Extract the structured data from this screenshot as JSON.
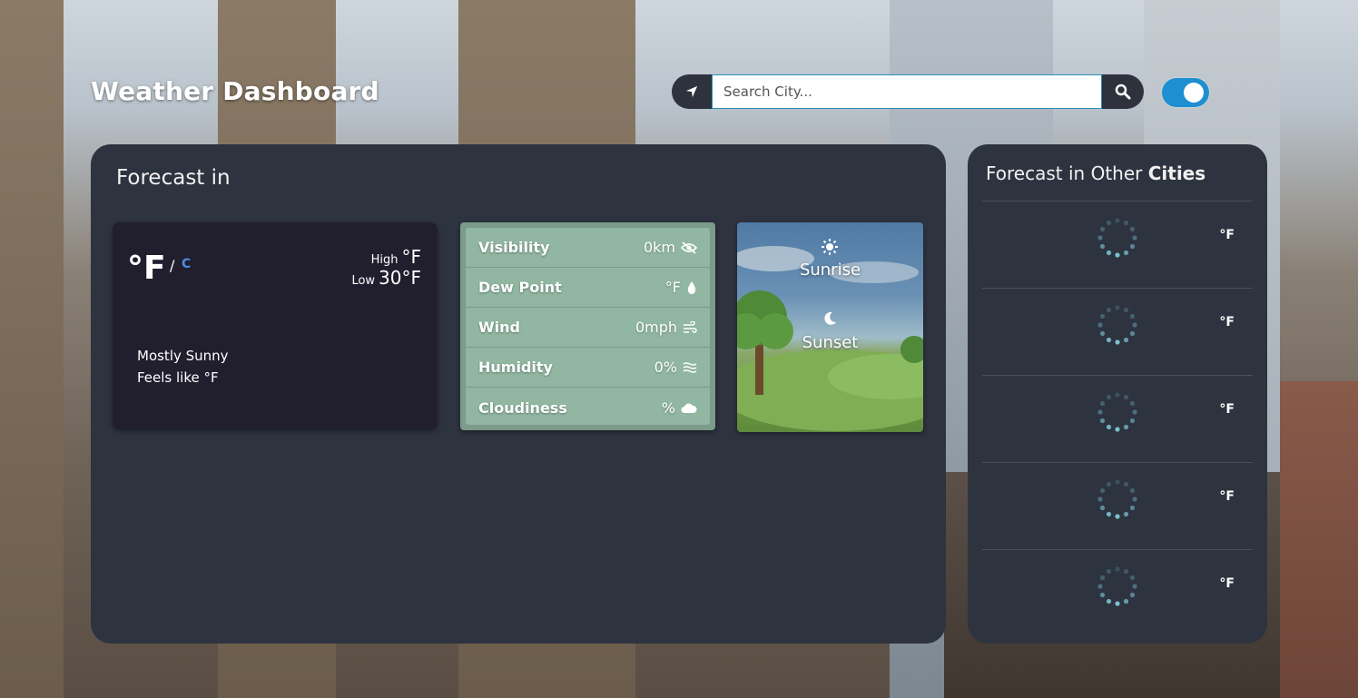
{
  "app": {
    "title": "Weather Dashboard"
  },
  "search": {
    "placeholder": "Search City..."
  },
  "main": {
    "heading": "Forecast in",
    "current": {
      "temp": "°F",
      "unit_sep": "/",
      "unit_alt": "C",
      "high_label": "High",
      "high_value": "°F",
      "low_label": "Low",
      "low_value": "30°F",
      "condition": "Mostly Sunny",
      "feels_like": "Feels like °F"
    },
    "details": [
      {
        "label": "Visibility",
        "value": "0km",
        "icon": "eye-slash-icon"
      },
      {
        "label": "Dew Point",
        "value": "°F",
        "icon": "droplet-icon"
      },
      {
        "label": "Wind",
        "value": "0mph",
        "icon": "wind-icon"
      },
      {
        "label": "Humidity",
        "value": "0%",
        "icon": "humidity-icon"
      },
      {
        "label": "Cloudiness",
        "value": "%",
        "icon": "cloud-icon"
      }
    ],
    "sun": {
      "sunrise": "Sunrise",
      "sunset": "Sunset"
    }
  },
  "side": {
    "heading_prefix": "Forecast in Other ",
    "heading_bold": "Cities",
    "cities": [
      {
        "unit": "°F"
      },
      {
        "unit": "°F"
      },
      {
        "unit": "°F"
      },
      {
        "unit": "°F"
      },
      {
        "unit": "°F"
      }
    ]
  },
  "colors": {
    "panel": "#2e3340",
    "current_card": "#211f2e",
    "details_card": "#91b6a2",
    "toggle": "#1e8fd1",
    "unit_link": "#4b8ee0"
  }
}
